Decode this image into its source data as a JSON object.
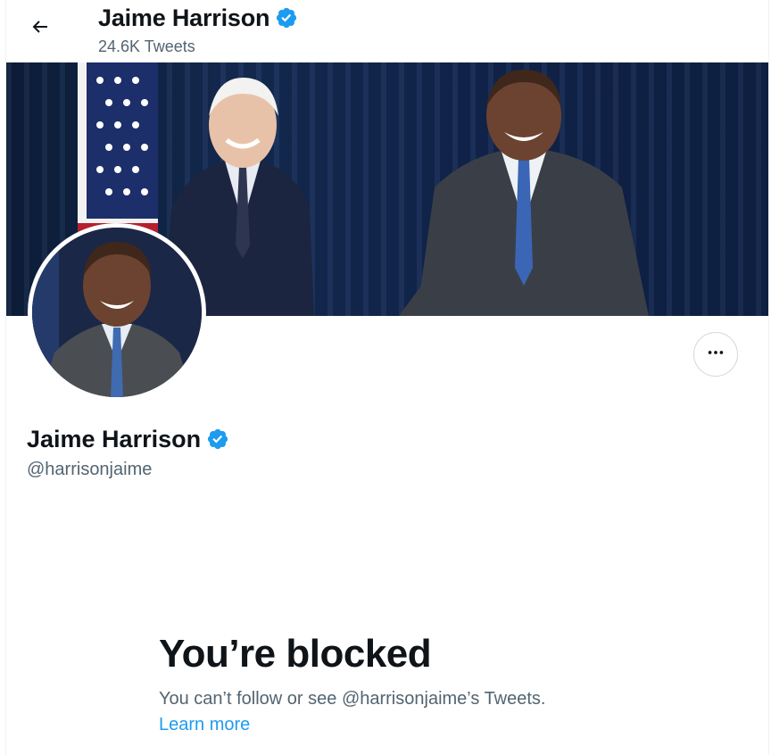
{
  "header": {
    "title": "Jaime Harrison",
    "tweet_count": "24.6K Tweets"
  },
  "profile": {
    "name": "Jaime Harrison",
    "handle": "@harrisonjaime"
  },
  "blocked": {
    "title": "You’re blocked",
    "description": "You can’t follow or see @harrisonjaime’s Tweets.",
    "learn_more": "Learn more"
  },
  "colors": {
    "accent": "#1d9bf0",
    "text_primary": "#0f1419",
    "text_secondary": "#536471",
    "verified": "#1d9bf0"
  },
  "icons": {
    "back": "arrow-left-icon",
    "verified": "verified-badge-icon",
    "more": "more-dots-icon"
  }
}
